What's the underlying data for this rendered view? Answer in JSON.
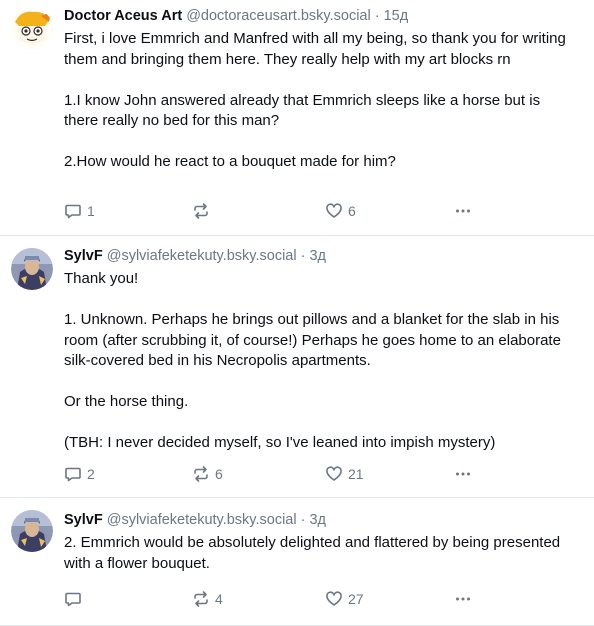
{
  "posts": [
    {
      "author": "Doctor Aceus Art",
      "handle": "@doctoraceusart.bsky.social",
      "separator": "·",
      "time": "15д",
      "text": "First, i love Emmrich and Manfred with all my being, so thank you for writing them and bringing them here. They really help with my art blocks rn\n\n1.I know John answered already that Emmrich sleeps like a horse but is there really no bed for this man?\n\n2.How would he react to a bouquet made for him?",
      "replies": "1",
      "reposts": "",
      "likes": "6"
    },
    {
      "author": "SylvF",
      "handle": "@sylviafeketekuty.bsky.social",
      "separator": "·",
      "time": "3д",
      "text": "Thank you!\n\n1. Unknown. Perhaps he brings out pillows and a blanket for the slab in his room (after scrubbing it, of course!) Perhaps he goes home to an elaborate silk-covered bed in his Necropolis apartments.\n\nOr the horse thing.\n\n(TBH: I never decided myself, so I've leaned into impish mystery)",
      "replies": "2",
      "reposts": "6",
      "likes": "21"
    },
    {
      "author": "SylvF",
      "handle": "@sylviafeketekuty.bsky.social",
      "separator": "·",
      "time": "3д",
      "text": "2. Emmrich would be absolutely delighted and flattered by being presented with a flower bouquet.",
      "replies": "",
      "reposts": "4",
      "likes": "27"
    }
  ],
  "icons": {
    "reply": "reply-icon",
    "repost": "repost-icon",
    "like": "heart-icon",
    "more": "more-options-icon"
  },
  "colors": {
    "text": "#0b0f14",
    "muted": "#6b7785",
    "divider": "#e3e7eb"
  }
}
